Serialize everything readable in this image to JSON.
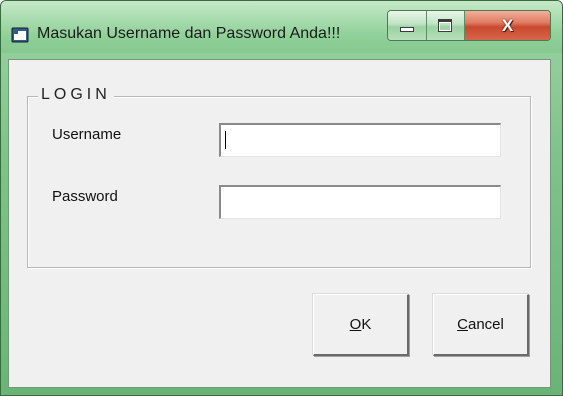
{
  "window": {
    "title": "Masukan Username dan Password Anda!!!",
    "controls": {
      "minimize_icon": "minimize-icon",
      "maximize_icon": "maximize-icon",
      "close_icon": "close-icon",
      "close_glyph": "X"
    },
    "accent_color": "#8fcf98"
  },
  "login_group": {
    "legend": "LOGIN",
    "fields": {
      "username": {
        "label": "Username",
        "value": ""
      },
      "password": {
        "label": "Password",
        "value": ""
      }
    }
  },
  "buttons": {
    "ok": {
      "mnemonic": "O",
      "rest": "K"
    },
    "cancel": {
      "mnemonic": "C",
      "rest": "ancel"
    }
  }
}
